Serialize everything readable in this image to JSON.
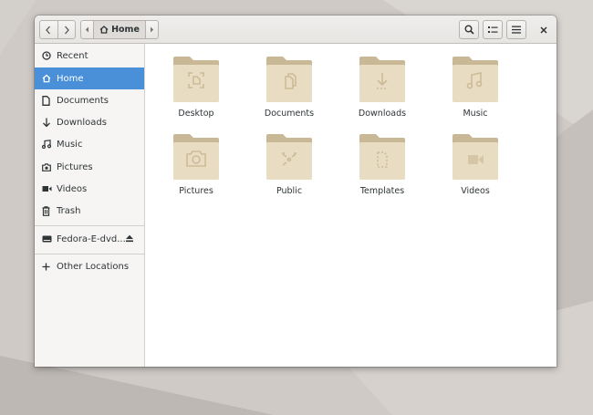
{
  "header": {
    "path_label": "Home"
  },
  "sidebar": {
    "items": [
      {
        "label": "Recent",
        "icon": "clock-icon"
      },
      {
        "label": "Home",
        "icon": "home-icon"
      },
      {
        "label": "Documents",
        "icon": "document-icon"
      },
      {
        "label": "Downloads",
        "icon": "download-icon"
      },
      {
        "label": "Music",
        "icon": "music-icon"
      },
      {
        "label": "Pictures",
        "icon": "camera-icon"
      },
      {
        "label": "Videos",
        "icon": "video-icon"
      },
      {
        "label": "Trash",
        "icon": "trash-icon"
      }
    ],
    "devices": [
      {
        "label": "Fedora-E-dvd...",
        "icon": "drive-icon"
      }
    ],
    "other": {
      "label": "Other Locations",
      "icon": "plus-icon"
    }
  },
  "folders": [
    {
      "label": "Desktop",
      "icon": "desktop-emblem-icon"
    },
    {
      "label": "Documents",
      "icon": "documents-emblem-icon"
    },
    {
      "label": "Downloads",
      "icon": "download-emblem-icon"
    },
    {
      "label": "Music",
      "icon": "music-emblem-icon"
    },
    {
      "label": "Pictures",
      "icon": "camera-emblem-icon"
    },
    {
      "label": "Public",
      "icon": "share-emblem-icon"
    },
    {
      "label": "Templates",
      "icon": "template-emblem-icon"
    },
    {
      "label": "Videos",
      "icon": "video-emblem-icon"
    }
  ],
  "colors": {
    "accent": "#4a90d9",
    "folder": "#e6d7bb",
    "folder_tab": "#c8b89a"
  }
}
